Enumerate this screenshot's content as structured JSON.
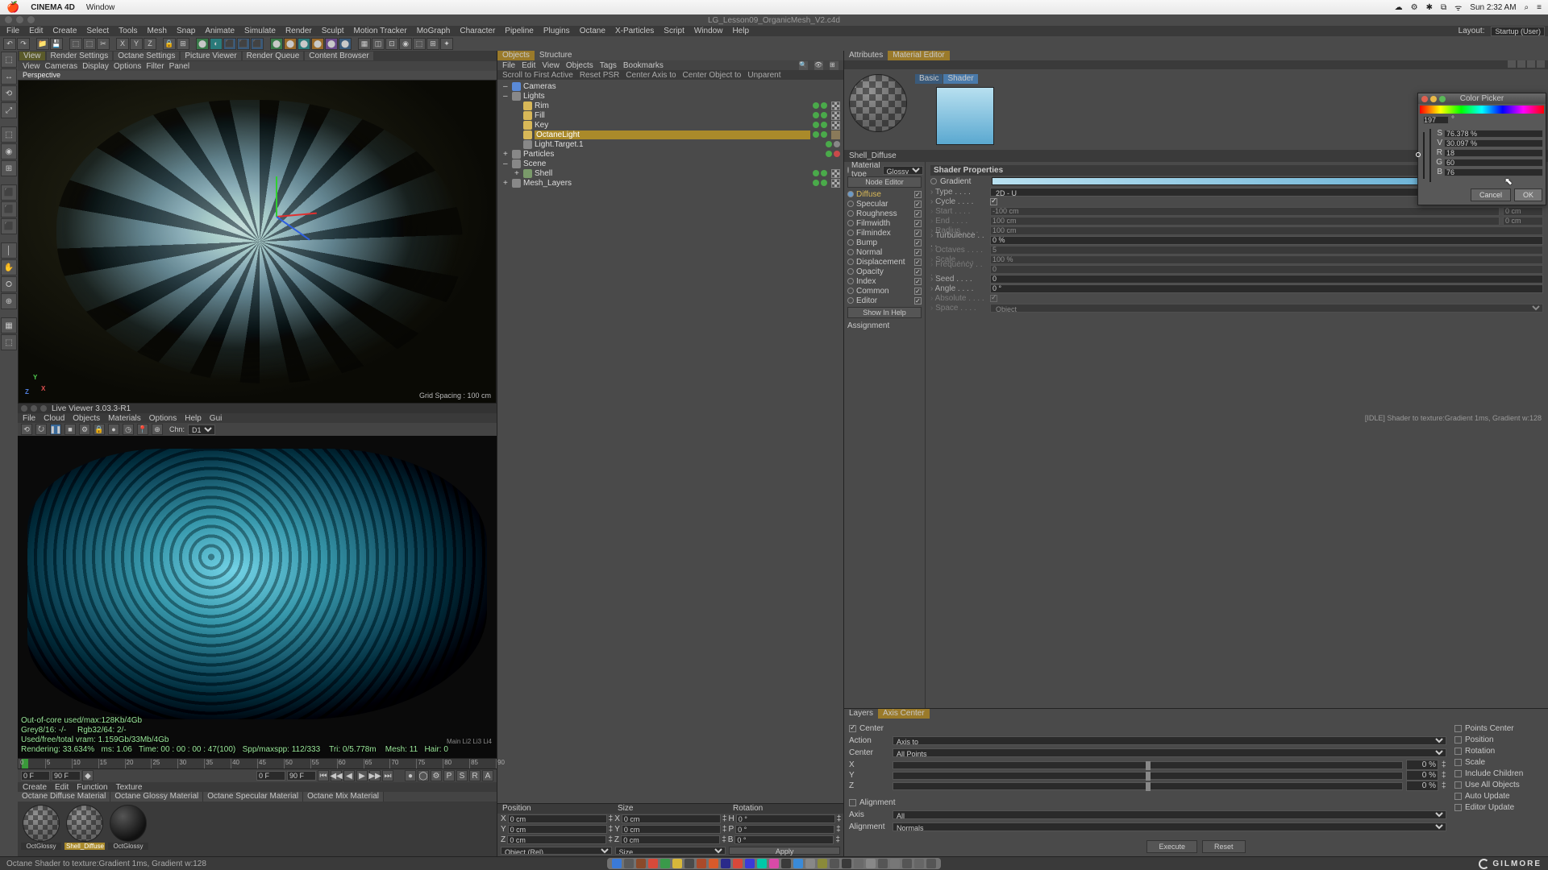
{
  "mac": {
    "app": "CINEMA 4D",
    "menu": [
      "Window"
    ],
    "right": [
      "☁",
      "⚙",
      "✱",
      "⧉",
      "ᯤ",
      "Sun 2:32 AM",
      "⌕",
      "≡"
    ]
  },
  "title": "LG_Lesson09_OrganicMesh_V2.c4d",
  "menubar": [
    "File",
    "Edit",
    "Create",
    "Select",
    "Tools",
    "Mesh",
    "Snap",
    "Animate",
    "Simulate",
    "Render",
    "Sculpt",
    "Motion Tracker",
    "MoGraph",
    "Character",
    "Pipeline",
    "Plugins",
    "Octane",
    "X-Particles",
    "Script",
    "Window",
    "Help"
  ],
  "layout": {
    "label": "Layout:",
    "value": "Startup (User)"
  },
  "viewTabs": [
    "View",
    "Render Settings",
    "Octane Settings",
    "Picture Viewer",
    "Render Queue",
    "Content Browser"
  ],
  "viewMenu": [
    "View",
    "Cameras",
    "Display",
    "Options",
    "Filter",
    "Panel"
  ],
  "vpName": "Perspective",
  "gridSpacing": "Grid Spacing : 100 cm",
  "liveViewer": {
    "title": "Live Viewer 3.03.3-R1",
    "menu": [
      "File",
      "Cloud",
      "Objects",
      "Materials",
      "Options",
      "Help",
      "Gui"
    ],
    "status": "[IDLE] Shader to texture:Gradient  1ms, Gradient w:128",
    "chnLabel": "Chn:",
    "chn": "D1",
    "stats": [
      "Out-of-core used/max:128Kb/4Gb",
      "Grey8/16: -/-     Rgb32/64: 2/-",
      "Used/free/total vram: 1.159Gb/33Mb/4Gb",
      "Rendering: 33.634%   ms: 1.06   Time: 00 : 00 : 00 : 47(100)   Spp/maxspp: 112/333    Tri: 0/5.778m    Mesh: 11   Hair: 0"
    ],
    "layers": "Main   Li2    Li3    Li4"
  },
  "timeline": {
    "start": "0 F",
    "end": "90 F",
    "cur": "0 F",
    "marks": [
      0,
      5,
      10,
      15,
      20,
      25,
      30,
      35,
      40,
      45,
      50,
      55,
      60,
      65,
      70,
      75,
      80,
      85,
      90
    ]
  },
  "matMenu": [
    "Create",
    "Edit",
    "Function",
    "Texture"
  ],
  "matTabs": [
    "Octane Diffuse Material",
    "Octane Glossy Material",
    "Octane Specular Material",
    "Octane Mix Material"
  ],
  "materials": [
    {
      "name": "OctGlossy",
      "type": "checker"
    },
    {
      "name": "Shell_Diffuse",
      "type": "checker",
      "sel": true
    },
    {
      "name": "OctGlossy",
      "type": "dark"
    }
  ],
  "objects": {
    "tabs": [
      "Objects",
      "Structure"
    ],
    "menu": [
      "File",
      "Edit",
      "View",
      "Objects",
      "Tags",
      "Bookmarks"
    ],
    "cmds": [
      "Scroll to First Active",
      "Reset PSR",
      "Center Axis to",
      "Center Object to",
      "Unparent"
    ],
    "tree": [
      {
        "d": 0,
        "exp": "–",
        "ico": "cam",
        "nm": "Cameras"
      },
      {
        "d": 0,
        "exp": "–",
        "ico": "null",
        "nm": "Lights"
      },
      {
        "d": 1,
        "exp": "",
        "ico": "light",
        "nm": "Rim",
        "dots": [
          "g",
          "g"
        ],
        "tags": [
          "chk"
        ]
      },
      {
        "d": 1,
        "exp": "",
        "ico": "light",
        "nm": "Fill",
        "dots": [
          "g",
          "g"
        ],
        "tags": [
          "chk"
        ]
      },
      {
        "d": 1,
        "exp": "",
        "ico": "light",
        "nm": "Key",
        "dots": [
          "g",
          "g"
        ],
        "tags": [
          "chk"
        ]
      },
      {
        "d": 1,
        "exp": "",
        "ico": "light",
        "nm": "OctaneLight",
        "sel": true,
        "dots": [
          "g",
          "g"
        ],
        "tags": [
          "t"
        ]
      },
      {
        "d": 1,
        "exp": "",
        "ico": "null",
        "nm": "Light.Target.1",
        "dots": [
          "g",
          "gr"
        ]
      },
      {
        "d": 0,
        "exp": "+",
        "ico": "null",
        "nm": "Particles",
        "dots": [
          "g",
          "r"
        ]
      },
      {
        "d": 0,
        "exp": "–",
        "ico": "null",
        "nm": "Scene"
      },
      {
        "d": 1,
        "exp": "+",
        "ico": "mesh",
        "nm": "Shell",
        "dots": [
          "g",
          "g"
        ],
        "tags": [
          "chk"
        ]
      },
      {
        "d": 0,
        "exp": "+",
        "ico": "null",
        "nm": "Mesh_Layers",
        "dots": [
          "g",
          "g"
        ],
        "tags": [
          "chk"
        ]
      }
    ]
  },
  "coords": {
    "heads": [
      "Position",
      "Size",
      "Rotation"
    ],
    "rows": [
      {
        "a": "X",
        "p": "0 cm",
        "s": "0 cm",
        "r": "H",
        "rv": "0 °"
      },
      {
        "a": "Y",
        "p": "0 cm",
        "s": "0 cm",
        "r": "P",
        "rv": "0 °"
      },
      {
        "a": "Z",
        "p": "0 cm",
        "s": "0 cm",
        "r": "B",
        "rv": "0 °"
      }
    ],
    "objMode": "Object (Rel)",
    "sizeMode": "Size",
    "apply": "Apply"
  },
  "attr": {
    "tabs": [
      "Attributes",
      "Material Editor"
    ],
    "shaderTabs": [
      "Basic",
      "Shader"
    ],
    "matName": "Shell_Diffuse",
    "matTypeLabel": "Material type",
    "matType": "Glossy",
    "nodeEditor": "Node Editor",
    "channels": [
      {
        "n": "Diffuse",
        "on": true,
        "sel": true
      },
      {
        "n": "Specular",
        "on": true
      },
      {
        "n": "Roughness",
        "on": true
      },
      {
        "n": "Filmwidth",
        "on": true
      },
      {
        "n": "Filmindex",
        "on": true
      },
      {
        "n": "Bump",
        "on": true
      },
      {
        "n": "Normal",
        "on": true
      },
      {
        "n": "Displacement",
        "on": true
      },
      {
        "n": "Opacity",
        "on": true
      },
      {
        "n": "Index",
        "on": true
      },
      {
        "n": "Common",
        "on": true
      },
      {
        "n": "Editor",
        "on": true
      }
    ],
    "showInHelp": "Show In Help",
    "assignment": "Assignment",
    "shaderHdr": "Shader Properties",
    "gradient": "Gradient",
    "props": [
      {
        "k": "Type",
        "v": "2D - U",
        "type": "select"
      },
      {
        "k": "Cycle",
        "v": "",
        "type": "check"
      },
      {
        "k": "Start",
        "v": "-100 cm",
        "v2": "0 cm",
        "dim": true
      },
      {
        "k": "End",
        "v": "100 cm",
        "v2": "0 cm",
        "dim": true
      },
      {
        "k": "Radius",
        "v": "100 cm",
        "dim": true
      },
      {
        "k": "Turbulence",
        "v": "0 %"
      },
      {
        "k": "Octaves",
        "v": "5",
        "dim": true
      },
      {
        "k": "Scale",
        "v": "100 %",
        "dim": true
      },
      {
        "k": "Frequency",
        "v": "0",
        "dim": true
      },
      {
        "k": "Seed",
        "v": "0"
      },
      {
        "k": "Angle",
        "v": "0 °"
      },
      {
        "k": "Absolute",
        "v": "",
        "dim": true,
        "type": "check"
      },
      {
        "k": "Space",
        "v": "Object",
        "dim": true,
        "type": "select"
      }
    ]
  },
  "axisCenter": {
    "tabs": [
      "Layers",
      "Axis Center"
    ],
    "center": "Center",
    "action": {
      "l": "Action",
      "v": "Axis to"
    },
    "centerSel": {
      "l": "Center",
      "v": "All Points"
    },
    "sliders": [
      {
        "l": "X",
        "v": "0 %"
      },
      {
        "l": "Y",
        "v": "0 %"
      },
      {
        "l": "Z",
        "v": "0 %"
      }
    ],
    "alignment": "Alignment",
    "axis": {
      "l": "Axis",
      "v": "All"
    },
    "align": {
      "l": "Alignment",
      "v": "Normals"
    },
    "side": [
      "Points Center",
      "Position",
      "Rotation",
      "Scale",
      "Include Children",
      "Use All Objects",
      "Auto Update",
      "Editor Update"
    ],
    "execute": "Execute",
    "reset": "Reset"
  },
  "colorPicker": {
    "title": "Color Picker",
    "hue": "197",
    "hueUnit": "°",
    "fields": [
      {
        "l": "S",
        "v": "76.378 %"
      },
      {
        "l": "V",
        "v": "30.097 %"
      },
      {
        "l": "R",
        "v": "18"
      },
      {
        "l": "G",
        "v": "60"
      },
      {
        "l": "B",
        "v": "76"
      }
    ],
    "cancel": "Cancel",
    "ok": "OK"
  },
  "status": "Octane Shader to texture:Gradient  1ms, Gradient w:128",
  "brand": "GILMORE",
  "dockColors": [
    "#3a7ad8",
    "#5a5a5a",
    "#8a4a2a",
    "#d84a3a",
    "#3a9a4a",
    "#d8b83a",
    "#4a4a4a",
    "#aa4a2a",
    "#d85a2a",
    "#2a2a8a",
    "#d8483a",
    "#3a3ad8",
    "#00c8a8",
    "#d84aa8",
    "#3a3a3a",
    "#3a8ad8",
    "#888",
    "#8a8a3a",
    "#555",
    "#3a3a3a",
    "#6a6a6a",
    "#888",
    "#555",
    "#777",
    "#555",
    "#666",
    "#555"
  ]
}
